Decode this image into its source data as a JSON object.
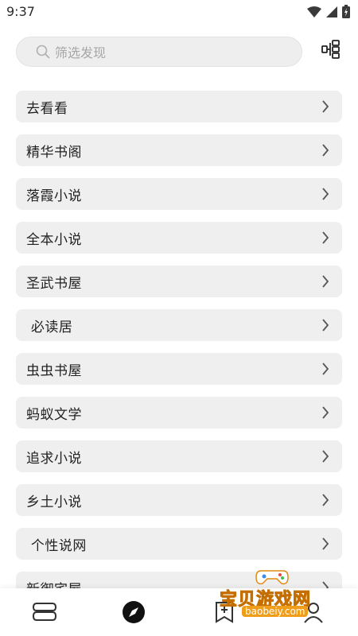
{
  "status_bar": {
    "time": "9:37",
    "icons": [
      "wifi-icon",
      "cellular-icon",
      "battery-icon"
    ]
  },
  "search": {
    "placeholder": "筛选发现"
  },
  "toolbar": {
    "group_icon": "group-toggle-icon"
  },
  "sources": [
    "去看看",
    "精华书阁",
    "落霞小说",
    "全本小说",
    "圣武书屋",
    " 必读居",
    "虫虫书屋",
    "蚂蚁文学",
    "追求小说",
    "乡土小说",
    " 个性说网",
    "新御宅屋"
  ],
  "bottom_nav": {
    "tabs": [
      "bookshelf-icon",
      "discover-icon",
      "rss-icon",
      "my-icon"
    ],
    "active_index": 1
  },
  "watermark": {
    "title": "宝贝游戏网",
    "url": "baobeiy.com"
  },
  "colors": {
    "item_background": "#efefef",
    "search_background": "#eeeeee",
    "watermark_accent": "#f0a020"
  }
}
